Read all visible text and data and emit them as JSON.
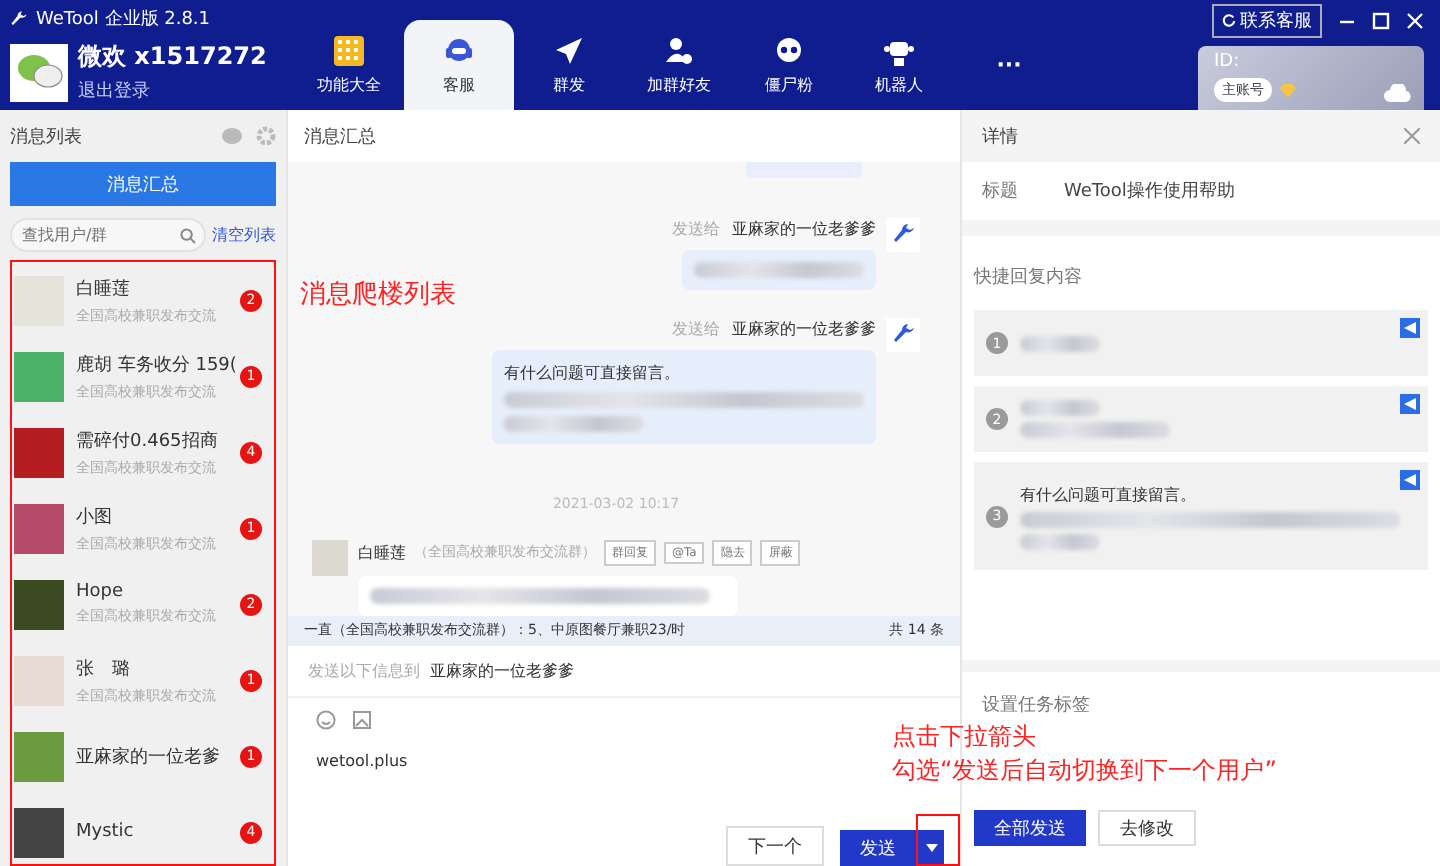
{
  "window": {
    "title": "WeTool 企业版 2.8.1"
  },
  "account": {
    "name": "微欢 x1517272",
    "logout": "退出登录"
  },
  "nav_tabs": [
    {
      "label": "功能大全",
      "kind": "grid",
      "selected": false
    },
    {
      "label": "客服",
      "kind": "support",
      "selected": true
    },
    {
      "label": "群发",
      "kind": "send",
      "selected": false
    },
    {
      "label": "加群好友",
      "kind": "adduser",
      "selected": false
    },
    {
      "label": "僵尸粉",
      "kind": "skull",
      "selected": false
    },
    {
      "label": "机器人",
      "kind": "robot",
      "selected": false
    },
    {
      "label": "···",
      "kind": "more",
      "selected": false
    }
  ],
  "contact_button": "联系客服",
  "id_card": {
    "label": "ID:",
    "badge": "主账号"
  },
  "message_list": {
    "title": "消息列表",
    "summary_button": "消息汇总",
    "search": {
      "placeholder": "查找用户/群"
    },
    "clear_link": "清空列表",
    "items": [
      {
        "name": "白睡莲",
        "subtitle": "全国高校兼职发布交流",
        "count": "2"
      },
      {
        "name": "鹿胡 车务收分 159(",
        "subtitle": "全国高校兼职发布交流",
        "count": "1"
      },
      {
        "name": "需碎付0.465招商",
        "subtitle": "全国高校兼职发布交流",
        "count": "4"
      },
      {
        "name": "小图",
        "subtitle": "全国高校兼职发布交流",
        "count": "1"
      },
      {
        "name": "Hope",
        "subtitle": "全国高校兼职发布交流",
        "count": "2"
      },
      {
        "name": "张　璐",
        "subtitle": "全国高校兼职发布交流",
        "count": "1"
      },
      {
        "name": "亚麻家的一位老爹",
        "count": "1"
      },
      {
        "name": "Mystic",
        "count": "4"
      }
    ]
  },
  "chat": {
    "title": "消息汇总",
    "annotation": "消息爬楼列表",
    "messages": [
      {
        "kind": "fragment"
      },
      {
        "kind": "outgoing",
        "prefix": "发送给",
        "recipient": "亚麻家的一位老爹爹"
      },
      {
        "kind": "outgoing",
        "prefix": "发送给",
        "recipient": "亚麻家的一位老爹爹",
        "text": "有什么问题可直接留言。"
      },
      {
        "kind": "time",
        "text": "2021-03-02 10:17"
      },
      {
        "kind": "incoming",
        "sender": "白睡莲",
        "group": "（全国高校兼职发布交流群）",
        "actions": [
          "群回复",
          "@Ta",
          "隐去",
          "屏蔽"
        ]
      }
    ]
  },
  "status_bar": {
    "preview": "一直（全国高校兼职发布交流群）：5、中原图餐厅兼职23/时",
    "count": "共 14 条"
  },
  "composer": {
    "send_to_label": "发送以下信息到",
    "recipient": "亚麻家的一位老爹爹",
    "value": "wetool.plus",
    "next_button": "下一个",
    "send_button": "发送",
    "annotation": [
      "点击下拉箭头",
      "勾选“发送后自动切换到下一个用户”"
    ]
  },
  "details": {
    "title": "详情",
    "field_label": "标题",
    "field_value": "WeTool操作使用帮助",
    "quick_reply_title": "快捷回复内容",
    "quick_replies": [
      {
        "number": "1"
      },
      {
        "number": "2"
      },
      {
        "number": "3",
        "text": "有什么问题可直接留言。"
      }
    ],
    "tag_section_title": "设置任务标签",
    "send_all_button": "全部发送",
    "edit_button": "去修改"
  }
}
